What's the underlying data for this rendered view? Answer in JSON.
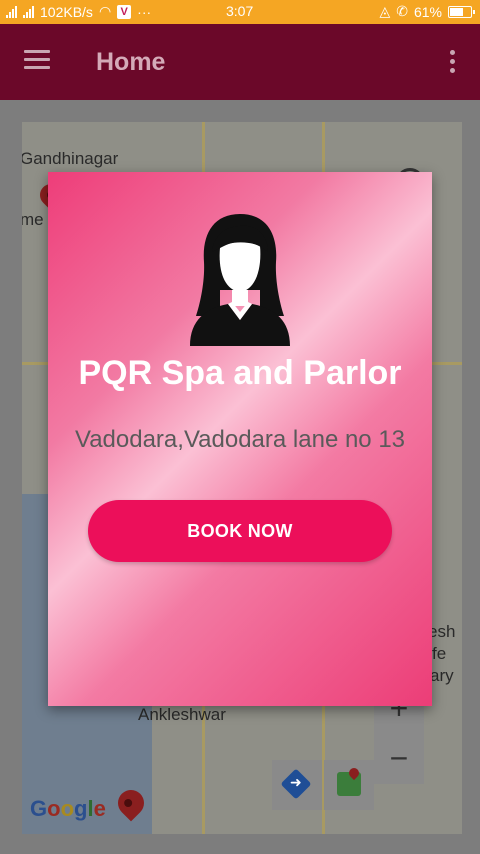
{
  "status_bar": {
    "network_speed": "102KB/s",
    "time": "3:07",
    "battery_percent": "61%",
    "ellipsis": "···",
    "carrier_badge": "V",
    "color": "#f5a623"
  },
  "app_bar": {
    "title": "Home",
    "color": "#6b0829"
  },
  "map": {
    "labels": {
      "gandhinagar": "Gandhinagar",
      "partial_left": "me",
      "ankleshwar": "Ankleshwar",
      "right_fragment_1": "esh",
      "right_fragment_2": "fe",
      "right_fragment_3": "ary"
    },
    "zoom_in_label": "+",
    "zoom_out_label": "−",
    "google_logo": [
      "G",
      "o",
      "o",
      "g",
      "l",
      "e"
    ],
    "google_logo_colors": [
      "#2b4f8e",
      "#9a2b22",
      "#a88a1f",
      "#2b4f8e",
      "#2f6b2f",
      "#9a2b22"
    ]
  },
  "dialog": {
    "shop_name": "PQR Spa and Parlor",
    "address": "Vadodara,Vadodara lane no 13",
    "book_button_label": "BOOK NOW",
    "avatar_icon": "woman-avatar-icon",
    "accent_color": "#ec0f5a"
  }
}
